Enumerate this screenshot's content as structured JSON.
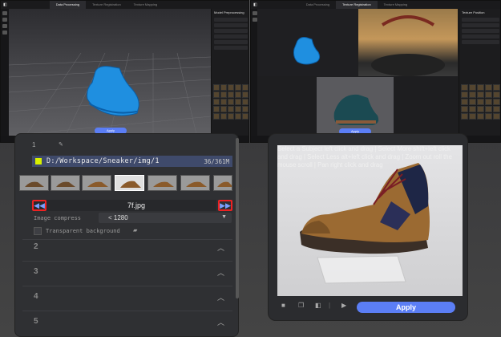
{
  "window_left": {
    "tabs": [
      "Data Processing",
      "Texture Registration",
      "Texture Mapping"
    ],
    "panel_title": "Model Preprocessing",
    "apply_label": "Apply"
  },
  "window_right": {
    "tabs": [
      "Data Processing",
      "Texture Registration",
      "Texture Mapping"
    ],
    "panel_title": "Texture Position",
    "apply_label": "Apply"
  },
  "dialog": {
    "path": "D:/Workspace/Sneaker/img/1",
    "count": "36/361M",
    "current_file": "7f.jpg",
    "image_compress_label": "Image compress",
    "image_compress_value": "< 1280",
    "transparent_label": "Transparent background",
    "sections": [
      "2",
      "3",
      "4",
      "5"
    ]
  },
  "preview": {
    "hint": "Select a Subject  left click and drag | Select More  shift+left click and drag | Select Less  alt+left click and drag | Zoom out  roll the mouse scroll | Pan  right click and drag",
    "apply_label": "Apply"
  },
  "colors": {
    "accent": "#5b7ef5",
    "highlight_box": "#e22222",
    "path_bar": "#3f4a6b",
    "folder_icon": "#d8f000"
  }
}
